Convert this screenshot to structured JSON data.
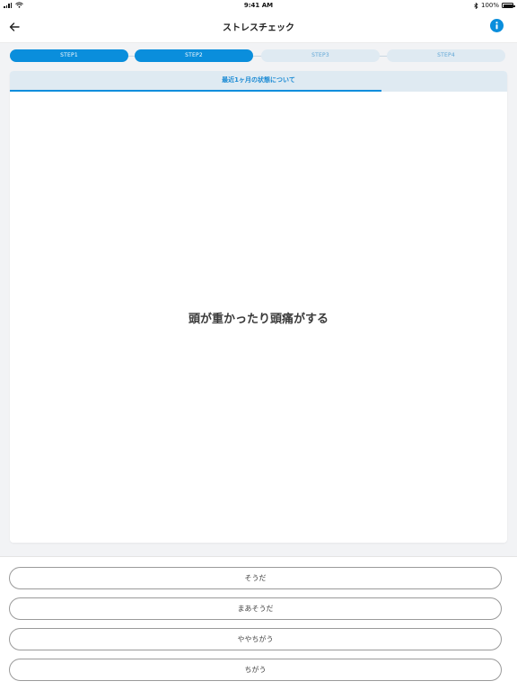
{
  "status_bar": {
    "time": "9:41 AM",
    "battery_text": "100%",
    "battery_level": 1.0,
    "icons": [
      "signal-icon",
      "wifi-icon",
      "bluetooth-icon",
      "battery-icon"
    ]
  },
  "nav": {
    "title": "ストレスチェック",
    "back_icon": "arrow-left-icon",
    "info_icon": "info-icon"
  },
  "steps": [
    {
      "label": "STEP1",
      "state": "done"
    },
    {
      "label": "STEP2",
      "state": "done"
    },
    {
      "label": "STEP3",
      "state": "todo"
    },
    {
      "label": "STEP4",
      "state": "todo"
    }
  ],
  "card": {
    "header": "最近1ヶ月の状態について",
    "progress": 0.747,
    "question": "頭が重かったり頭痛がする"
  },
  "answers": [
    {
      "label": "そうだ"
    },
    {
      "label": "まあそうだ"
    },
    {
      "label": "ややちがう"
    },
    {
      "label": "ちがう"
    }
  ],
  "colors": {
    "accent": "#0a8edc",
    "step_inactive_bg": "#dfeaf2",
    "step_inactive_text": "#5fa6d6",
    "page_bg": "#f2f3f5"
  }
}
